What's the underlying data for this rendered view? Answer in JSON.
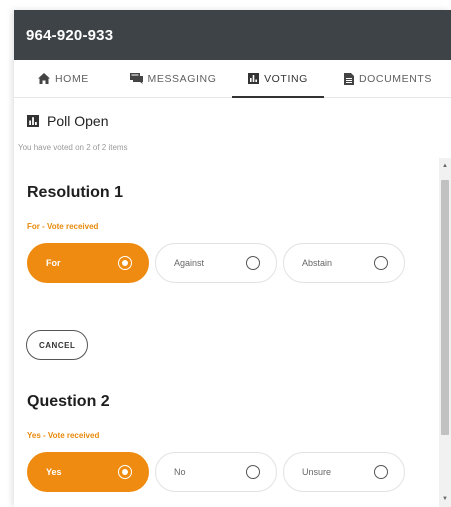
{
  "header": {
    "title": "964-920-933"
  },
  "tabs": [
    {
      "label": "HOME",
      "icon": "home-icon"
    },
    {
      "label": "MESSAGING",
      "icon": "chat-icon"
    },
    {
      "label": "VOTING",
      "icon": "bar-chart-icon",
      "active": true
    },
    {
      "label": "DOCUMENTS",
      "icon": "document-icon"
    }
  ],
  "poll": {
    "status": "Poll Open",
    "voted_summary": "You have voted on 2 of 2 items"
  },
  "items": [
    {
      "title": "Resolution 1",
      "vote_status": "For - Vote received",
      "options": [
        {
          "label": "For",
          "selected": true
        },
        {
          "label": "Against",
          "selected": false
        },
        {
          "label": "Abstain",
          "selected": false
        }
      ],
      "cancel_label": "CANCEL"
    },
    {
      "title": "Question 2",
      "vote_status": "Yes - Vote received",
      "options": [
        {
          "label": "Yes",
          "selected": true
        },
        {
          "label": "No",
          "selected": false
        },
        {
          "label": "Unsure",
          "selected": false
        }
      ]
    }
  ],
  "colors": {
    "accent": "#ee8b10",
    "status_text": "#e8890b",
    "topbar": "#3d4347"
  }
}
